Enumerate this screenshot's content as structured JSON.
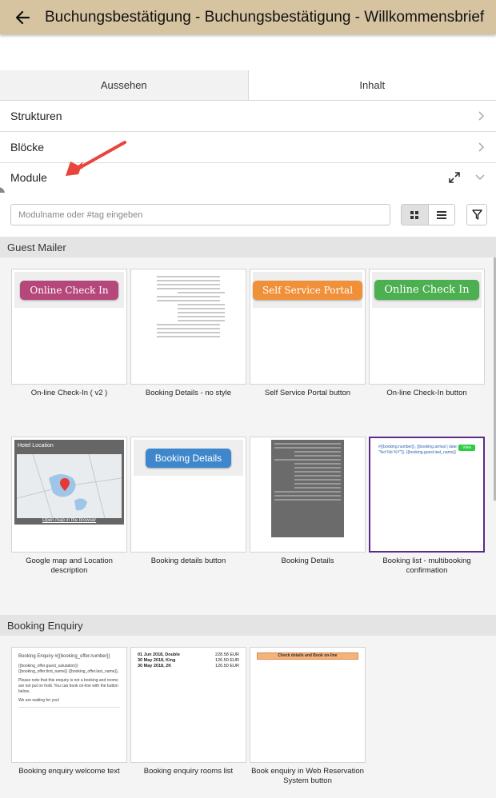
{
  "header": {
    "title": "Buchungsbestätigung - Buchungsbestätigung - Willkommensbrief"
  },
  "tabs": [
    {
      "label": "Aussehen",
      "active": false
    },
    {
      "label": "Inhalt",
      "active": true
    }
  ],
  "accordion": [
    {
      "label": "Strukturen",
      "expanded": false
    },
    {
      "label": "Blöcke",
      "expanded": false
    },
    {
      "label": "Module",
      "expanded": true
    }
  ],
  "search": {
    "placeholder": "Modulname oder #tag eingeben",
    "value": ""
  },
  "view_mode": "grid",
  "sections": [
    {
      "title": "Guest Mailer",
      "tiles": [
        {
          "label": "On-line Check-In ( v2 )",
          "preview": "pill",
          "button_text": "Online Check In",
          "color": "#b5477a"
        },
        {
          "label": "Booking Details - no style",
          "preview": "lines"
        },
        {
          "label": "Self Service Portal button",
          "preview": "pill",
          "button_text": "Self Service Portal",
          "color": "#f0913a"
        },
        {
          "label": "On-line Check-In button",
          "preview": "pill",
          "button_text": "Online Check In",
          "color": "#4caf50"
        },
        {
          "label": "Google map and Location description",
          "preview": "map",
          "header_text": "Hotel Location",
          "link_text": "Open map in the browser"
        },
        {
          "label": "Booking details button",
          "preview": "pill",
          "button_text": "Booking Details",
          "color": "#3f87cc"
        },
        {
          "label": "Booking Details",
          "preview": "dark-table"
        },
        {
          "label": "Booking list - multibooking confirmation",
          "preview": "list",
          "selected": true,
          "preview_text": "#{{booking.number}}, {{booking.arrival | date: \"%d %b %Y\"}}, {{booking.guest.last_name}}",
          "badge_text": "View"
        }
      ]
    },
    {
      "title": "Booking Enquiry",
      "tiles": [
        {
          "label": "Booking enquiry welcome text",
          "preview": "letter",
          "heading": "Booking Enquiry #{{booking_offer.number}}",
          "lines": [
            "{{booking_offer.guest_salutation}} {{booking_offer.first_name}} {{booking_offer.last_name}},",
            "Please note that this enquiry is not a booking and rooms are not put on hold. You can book on-line with the button below.",
            "We are waiting for you!"
          ]
        },
        {
          "label": "Booking enquiry rooms list",
          "preview": "rooms",
          "rows": [
            {
              "left": "01 Jun 2018, Double",
              "right": "228.58 EUR"
            },
            {
              "left": "30 May 2018, King",
              "right": "126.50 EUR"
            },
            {
              "left": "30 May 2018, 2K",
              "right": "126.50 EUR"
            }
          ]
        },
        {
          "label": "Book enquiry in Web Reservation System button",
          "preview": "bar",
          "bar_text": "Check details and Book on-line"
        }
      ]
    }
  ]
}
